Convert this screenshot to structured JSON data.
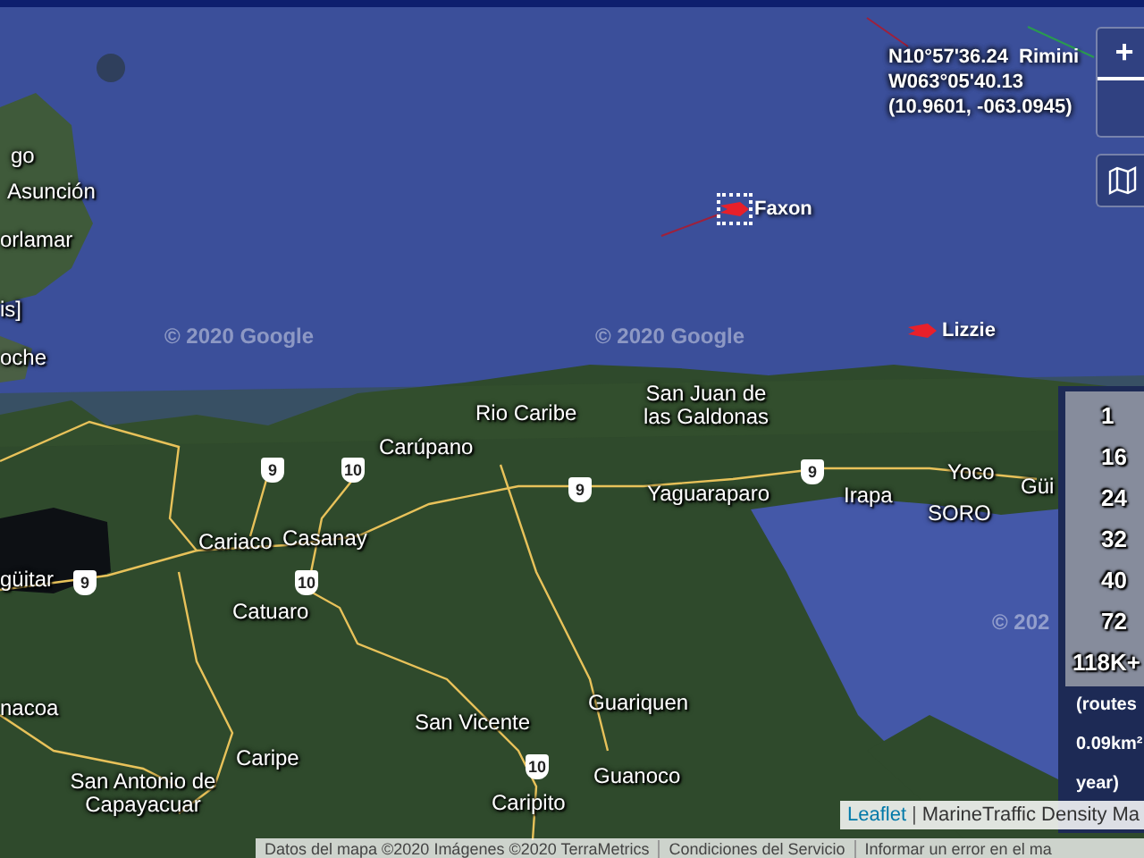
{
  "map": {
    "places": [
      {
        "text": "go"
      },
      {
        "text": "Asunción"
      },
      {
        "text": "orlamar"
      },
      {
        "text": "is]"
      },
      {
        "text": "oche"
      },
      {
        "text": "Rio Caribe"
      },
      {
        "text": "Carúpano"
      },
      {
        "text": "San Juan de las Galdonas"
      },
      {
        "text": "Cariaco"
      },
      {
        "text": "Casanay"
      },
      {
        "text": "Catuaro"
      },
      {
        "text": "Yaguaraparo"
      },
      {
        "text": "Irapa"
      },
      {
        "text": "Yoco"
      },
      {
        "text": "SORO"
      },
      {
        "text": "Güi"
      },
      {
        "text": "güitar"
      },
      {
        "text": "nacoa"
      },
      {
        "text": "San Vicente"
      },
      {
        "text": "Guariquen"
      },
      {
        "text": "Caripe"
      },
      {
        "text": "San Antonio de Capayacuar"
      },
      {
        "text": "Guanoco"
      },
      {
        "text": "Caripito"
      }
    ],
    "road_shields": [
      "9",
      "10",
      "9",
      "10",
      "9",
      "9",
      "10"
    ],
    "watermarks": [
      "© 2020 Google",
      "© 2020 Google",
      "© 202"
    ],
    "vessels": [
      {
        "kind": "ship",
        "name": "Faxon",
        "color": "#e8202a",
        "selected": true
      },
      {
        "kind": "ship",
        "name": "Lizzie",
        "color": "#e8202a",
        "selected": false
      },
      {
        "kind": "label",
        "name": "Rimini"
      }
    ],
    "coordinates": [
      "N10°57'36.24",
      "W063°05'40.13",
      "(10.9601, -063.0945)"
    ]
  },
  "controls": {
    "zoom_in": "+"
  },
  "legend": {
    "values": [
      "1",
      "16",
      "24",
      "32",
      "40",
      "72",
      "118K+"
    ],
    "note": [
      "(routes",
      "0.09km²",
      "year)"
    ]
  },
  "attribution": {
    "leaflet": "Leaflet",
    "separator": "|",
    "source": "MarineTraffic Density Ma"
  },
  "footer": [
    "Datos del mapa ©2020 Imágenes ©2020 TerraMetrics",
    "Condiciones del Servicio",
    "Informar un error en el ma"
  ]
}
